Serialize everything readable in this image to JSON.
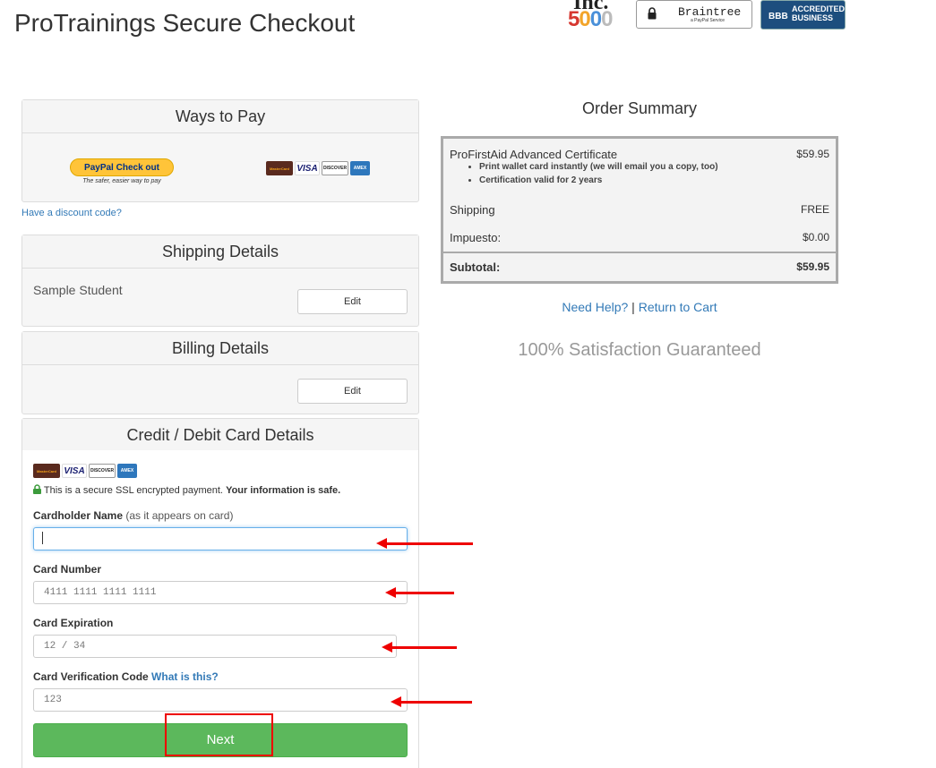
{
  "header": {
    "title": "ProTrainings Secure Checkout",
    "inc_top": "Inc.",
    "inc_num": [
      "5",
      "0",
      "0",
      "0"
    ],
    "braintree_name": "Braintree",
    "braintree_sub": "a PayPal Service",
    "bbb_seal": "BBB",
    "bbb_text_1": "ACCREDITED",
    "bbb_text_2": "BUSINESS"
  },
  "ways_to_pay": {
    "heading": "Ways to Pay",
    "paypal_label": "PayPal Check out",
    "paypal_tagline": "The safer, easier way to pay",
    "cards": [
      "MasterCard",
      "VISA",
      "DISCOVER",
      "AMEX"
    ]
  },
  "discount_link": "Have a discount code?",
  "shipping": {
    "heading": "Shipping Details",
    "name": "Sample Student",
    "edit_label": "Edit"
  },
  "billing": {
    "heading": "Billing Details",
    "edit_label": "Edit"
  },
  "card_form": {
    "heading": "Credit / Debit Card Details",
    "ssl_text": "This is a secure SSL encrypted payment.",
    "ssl_bold": "Your information is safe.",
    "cardholder_label": "Cardholder Name",
    "cardholder_hint": "(as it appears on card)",
    "cardholder_value": "",
    "card_number_label": "Card Number",
    "card_number_placeholder": "4111 1111 1111 1111",
    "expiration_label": "Card Expiration",
    "expiration_placeholder": "12 / 34",
    "cvc_label": "Card Verification Code",
    "cvc_link": "What is this?",
    "cvc_placeholder": "123",
    "next_label": "Next"
  },
  "order_summary": {
    "heading": "Order Summary",
    "item_name": "ProFirstAid Advanced Certificate",
    "item_price": "$59.95",
    "item_bullets": [
      "Print wallet card instantly (we will email you a copy, too)",
      "Certification valid for 2 years"
    ],
    "shipping_label": "Shipping",
    "shipping_value": "FREE",
    "tax_label": "Impuesto:",
    "tax_value": "$0.00",
    "subtotal_label": "Subtotal:",
    "subtotal_value": "$59.95"
  },
  "help": {
    "need_help": "Need Help?",
    "separator": "|",
    "return_cart": "Return to Cart"
  },
  "guarantee": "100% Satisfaction Guaranteed",
  "colors": {
    "accent": "#337ab7",
    "next_button": "#5cb85c",
    "annotation": "#ee0000"
  }
}
